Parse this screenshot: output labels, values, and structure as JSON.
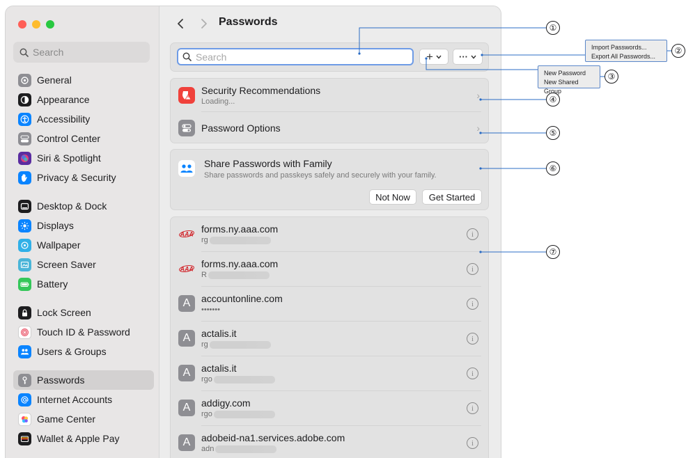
{
  "sidebar": {
    "search_placeholder": "Search",
    "items": [
      {
        "label": "General",
        "icon": "gear-icon",
        "color": "#8e8e93"
      },
      {
        "label": "Appearance",
        "icon": "appearance-icon",
        "color": "#1d1d1f"
      },
      {
        "label": "Accessibility",
        "icon": "accessibility-icon",
        "color": "#0a84ff"
      },
      {
        "label": "Control Center",
        "icon": "control-center-icon",
        "color": "#8e8e93"
      },
      {
        "label": "Siri & Spotlight",
        "icon": "siri-icon",
        "color": "#5a2ca0"
      },
      {
        "label": "Privacy & Security",
        "icon": "hand-icon",
        "color": "#0a84ff"
      },
      {
        "label": "Desktop & Dock",
        "icon": "dock-icon",
        "color": "#1d1d1f"
      },
      {
        "label": "Displays",
        "icon": "sun-icon",
        "color": "#0a84ff"
      },
      {
        "label": "Wallpaper",
        "icon": "wallpaper-icon",
        "color": "#30b0e8"
      },
      {
        "label": "Screen Saver",
        "icon": "screen-saver-icon",
        "color": "#4ab5d8"
      },
      {
        "label": "Battery",
        "icon": "battery-icon",
        "color": "#34c759"
      },
      {
        "label": "Lock Screen",
        "icon": "lock-icon",
        "color": "#1d1d1f"
      },
      {
        "label": "Touch ID & Password",
        "icon": "fingerprint-icon",
        "color": "#ffffff"
      },
      {
        "label": "Users & Groups",
        "icon": "users-icon",
        "color": "#0a84ff"
      },
      {
        "label": "Passwords",
        "icon": "key-icon",
        "color": "#8e8e93"
      },
      {
        "label": "Internet Accounts",
        "icon": "at-icon",
        "color": "#0a84ff"
      },
      {
        "label": "Game Center",
        "icon": "game-center-icon",
        "color": "#ffffff"
      },
      {
        "label": "Wallet & Apple Pay",
        "icon": "wallet-icon",
        "color": "#1d1d1f"
      }
    ]
  },
  "header": {
    "title": "Passwords"
  },
  "toolbar": {
    "search_placeholder": "Search",
    "add_label": "+",
    "more_label": "···"
  },
  "security": {
    "title": "Security Recommendations",
    "subtitle": "Loading..."
  },
  "options": {
    "title": "Password Options"
  },
  "family": {
    "title": "Share Passwords with Family",
    "subtitle": "Share passwords and passkeys safely and securely with your family.",
    "not_now": "Not Now",
    "get_started": "Get Started"
  },
  "passwords": [
    {
      "site": "forms.ny.aaa.com",
      "user": "rg",
      "icon": "aaa"
    },
    {
      "site": "forms.ny.aaa.com",
      "user": "R",
      "icon": "aaa"
    },
    {
      "site": "accountonline.com",
      "user": "•••••••",
      "icon": "A"
    },
    {
      "site": "actalis.it",
      "user": "rg",
      "icon": "A"
    },
    {
      "site": "actalis.it",
      "user": "rgo",
      "icon": "A"
    },
    {
      "site": "addigy.com",
      "user": "rgo",
      "icon": "A"
    },
    {
      "site": "adobeid-na1.services.adobe.com",
      "user": "adn",
      "icon": "A"
    }
  ],
  "annotations": {
    "menu_more": [
      "Import Passwords...",
      "Export All Passwords..."
    ],
    "menu_add": [
      "New Password",
      "New Shared Group"
    ],
    "badges": [
      "①",
      "②",
      "③",
      "④",
      "⑤",
      "⑥",
      "⑦"
    ],
    "line_color": "#2b6cc4"
  },
  "colors": {
    "accent": "#0a84ff",
    "security_red": "#f0413b"
  }
}
